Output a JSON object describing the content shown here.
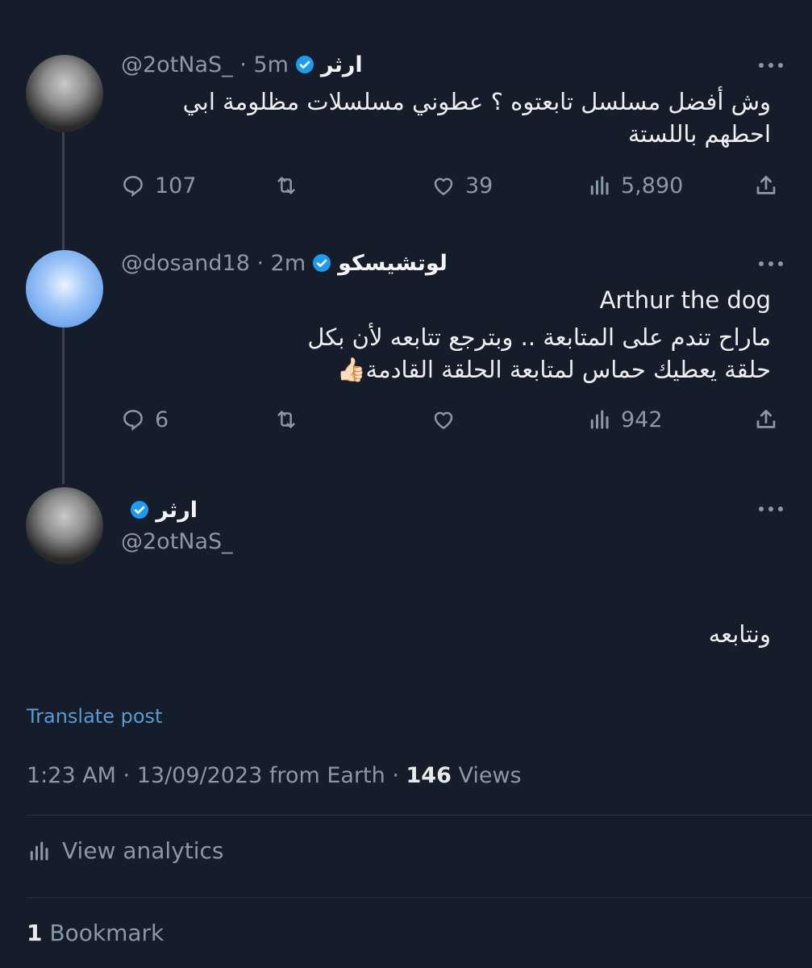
{
  "tweets": [
    {
      "display_name": "ارثر",
      "handle": "@2otNaS_",
      "time": "5m",
      "text": "وش أفضل مسلسل تابعتوه ؟ عطوني مسلسلات مظلومة ابي احطهم باللستة",
      "actions": {
        "reply": "107",
        "retweet": "",
        "like": "39",
        "views": "5,890"
      },
      "avatar": "man-in-cap-photo"
    },
    {
      "display_name": "لوتشيسكو",
      "handle": "@dosand18",
      "time": "2m",
      "text_line1": "Arthur the dog",
      "text_line2": "ماراح تندم على المتابعة .. وبترجع تتابعه لأن بكل",
      "text_line3": "حلقة يعطيك حماس لمتابعة الحلقة القادمة👍🏻",
      "actions": {
        "reply": "6",
        "retweet": "",
        "like": "",
        "views": "942"
      },
      "avatar": "man-standing-photo"
    }
  ],
  "focused": {
    "display_name": "ارثر",
    "handle": "@2otNaS_",
    "text": "ونتابعه",
    "translate_label": "Translate post",
    "timestamp": "1:23 AM · 13/09/2023 from Earth · ",
    "views_count": "146",
    "views_label": " Views",
    "analytics_label": "View analytics",
    "bookmarks_count": "1",
    "bookmarks_label": " Bookmark"
  },
  "separators": {
    "handle_time": " · "
  },
  "icons": [
    "verified-badge-icon",
    "more-icon",
    "reply-icon",
    "retweet-icon",
    "like-icon",
    "views-icon",
    "share-icon",
    "analytics-icon"
  ],
  "colors": {
    "background": "#151c2a",
    "verified": "#1d9bf0",
    "link": "#5b9bd5",
    "muted": "#8b98a5"
  }
}
